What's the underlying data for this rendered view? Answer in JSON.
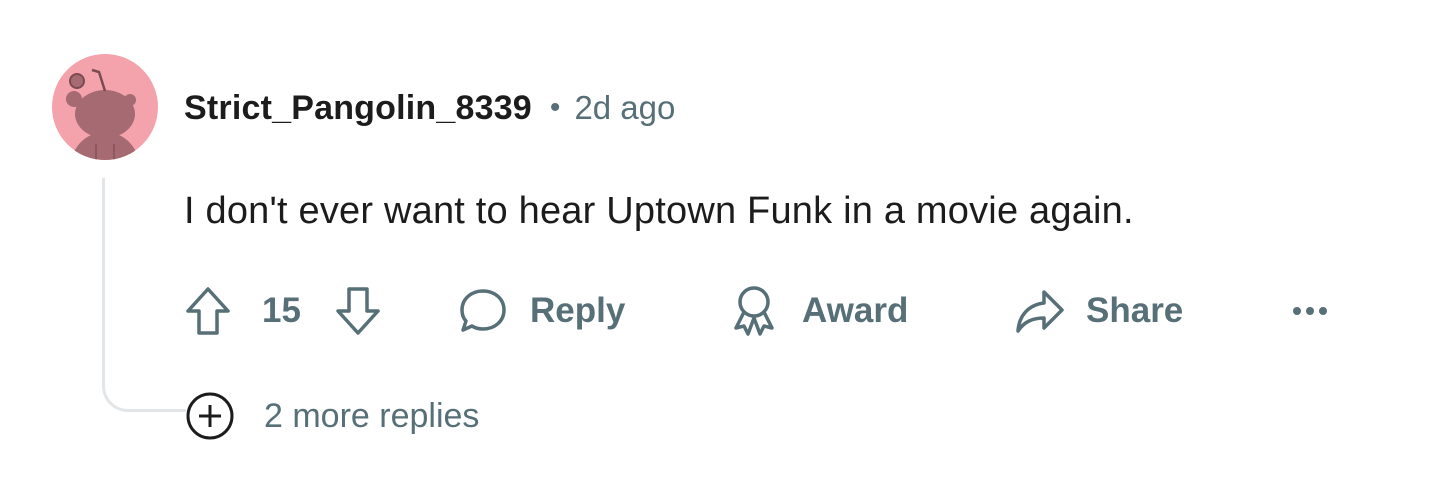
{
  "comment": {
    "author": "Strict_Pangolin_8339",
    "separator": "•",
    "timestamp": "2d ago",
    "text": "I don't ever want to hear Uptown Funk in a movie again.",
    "avatar_icon": "snoo-avatar-icon",
    "avatar_color": "#f4a3ac"
  },
  "actions": {
    "upvote_icon": "upvote-arrow-icon",
    "vote_count": "15",
    "downvote_icon": "downvote-arrow-icon",
    "reply_label": "Reply",
    "reply_icon": "speech-bubble-icon",
    "award_label": "Award",
    "award_icon": "ribbon-award-icon",
    "share_label": "Share",
    "share_icon": "share-arrow-icon",
    "more_icon": "ellipsis-icon"
  },
  "replies": {
    "label": "2 more replies",
    "icon": "plus-circle-icon"
  },
  "colors": {
    "text_primary": "#1c1c1c",
    "text_secondary": "#576f76",
    "thread_line": "#e3e6e8"
  }
}
